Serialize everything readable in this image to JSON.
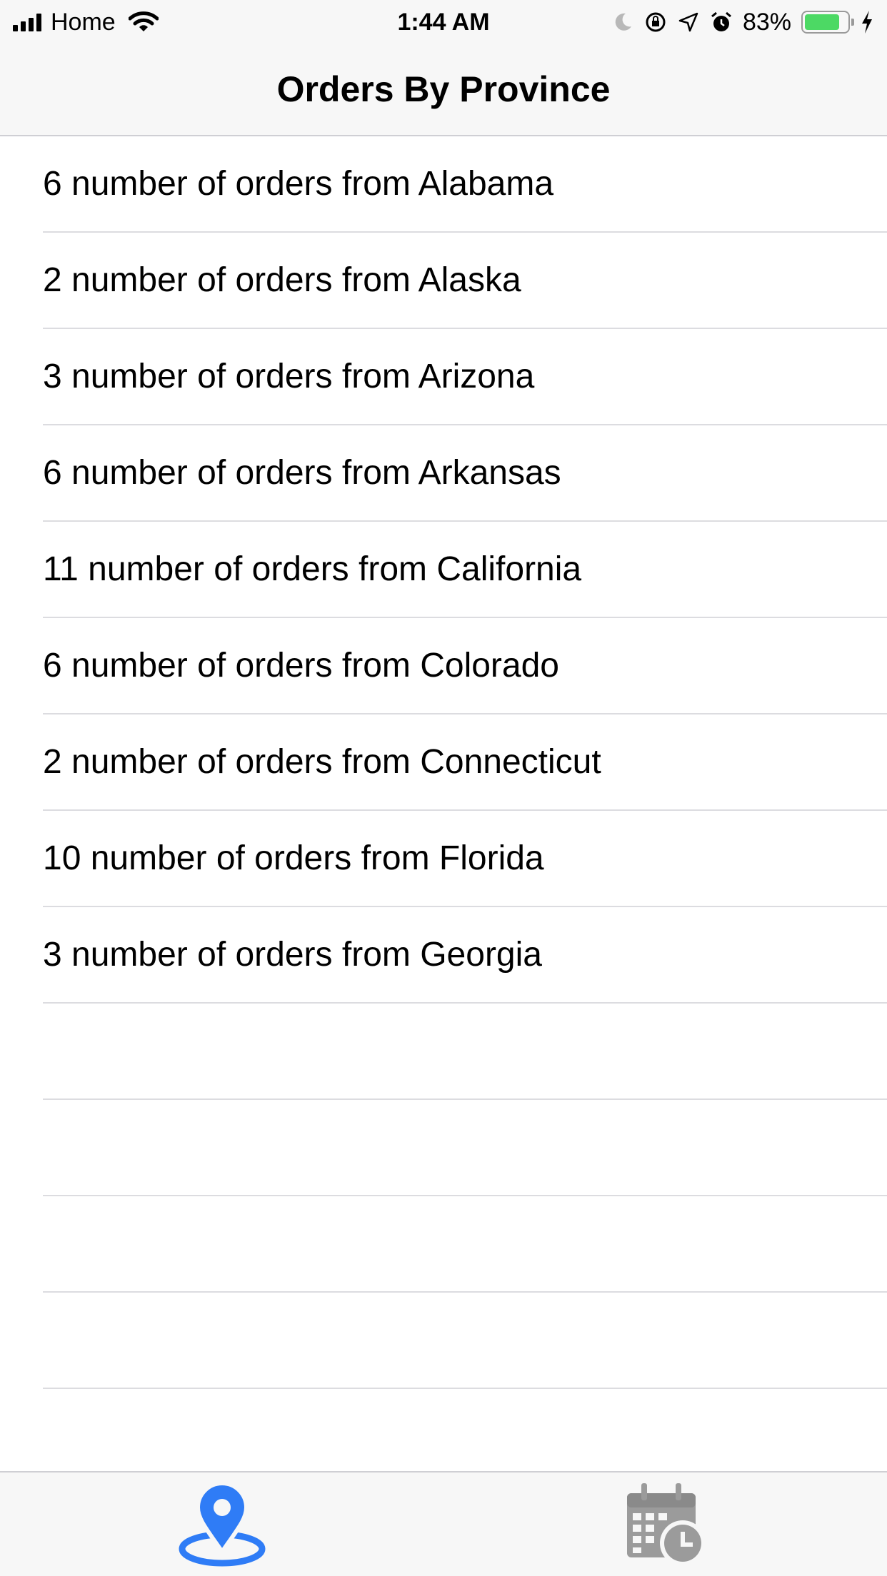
{
  "status_bar": {
    "carrier": "Home",
    "time": "1:44 AM",
    "battery_percent": "83%",
    "battery_level": 0.83,
    "icons": [
      "signal-icon",
      "wifi-icon",
      "moon-icon",
      "rotation-lock-icon",
      "location-arrow-icon",
      "alarm-icon",
      "battery-icon",
      "charging-bolt-icon"
    ]
  },
  "nav": {
    "title": "Orders By Province"
  },
  "orders": [
    {
      "text": "6 number of orders from Alabama"
    },
    {
      "text": "2 number of orders from Alaska"
    },
    {
      "text": "3 number of orders from Arizona"
    },
    {
      "text": "6 number of orders from Arkansas"
    },
    {
      "text": "11 number of orders from California"
    },
    {
      "text": "6 number of orders from Colorado"
    },
    {
      "text": "2 number of orders from Connecticut"
    },
    {
      "text": "10 number of orders from Florida"
    },
    {
      "text": "3 number of orders from Georgia"
    }
  ],
  "tab_bar": {
    "tabs": [
      {
        "icon": "map-pin-icon",
        "selected": true,
        "color": "#2f7cf6"
      },
      {
        "icon": "calendar-clock-icon",
        "selected": false,
        "color": "#9b9b9b"
      }
    ]
  },
  "colors": {
    "accent": "#2f7cf6",
    "battery_fill": "#4cd964",
    "bar_background": "#f7f7f7",
    "separator": "#dcdce0"
  }
}
